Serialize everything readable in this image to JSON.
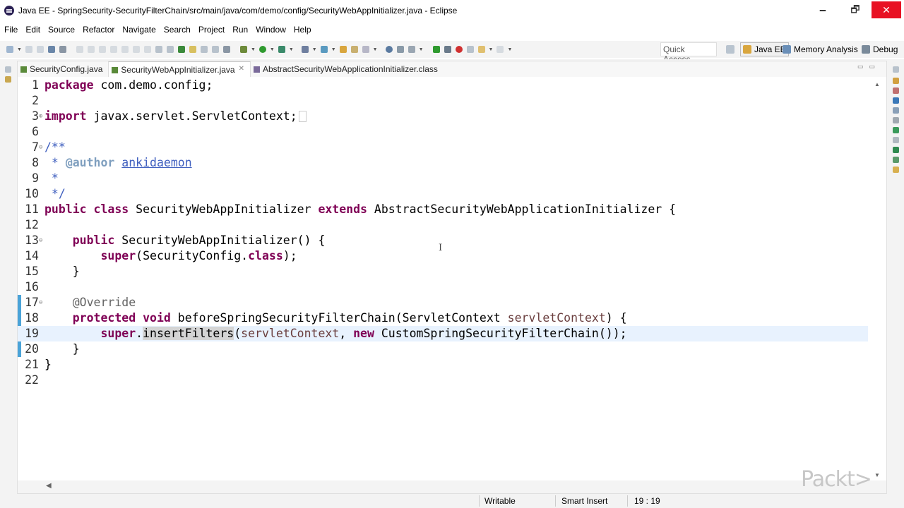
{
  "window": {
    "title": "Java EE - SpringSecurity-SecurityFilterChain/src/main/java/com/demo/config/SecurityWebAppInitializer.java - Eclipse",
    "controls": {
      "minimize": "🗕",
      "restore": "🗗",
      "close": "✕"
    }
  },
  "menu": [
    "File",
    "Edit",
    "Source",
    "Refactor",
    "Navigate",
    "Search",
    "Project",
    "Run",
    "Window",
    "Help"
  ],
  "toolbar": {
    "quick_access": "Quick Access",
    "perspectives": [
      "Java EE",
      "Memory Analysis",
      "Debug"
    ],
    "active_perspective": "Java EE"
  },
  "tabs": [
    {
      "label": "SecurityConfig.java",
      "icon": "java-file-icon"
    },
    {
      "label": "SecurityWebAppInitializer.java",
      "icon": "java-file-icon",
      "active": true,
      "close": "✕"
    },
    {
      "label": "AbstractSecurityWebApplicationInitializer.class",
      "icon": "class-file-icon"
    }
  ],
  "editor": {
    "lines": [
      {
        "n": "1",
        "fold": "",
        "html": "<span class=\"kw\">package</span> com.demo.config;"
      },
      {
        "n": "2",
        "fold": "",
        "html": ""
      },
      {
        "n": "3",
        "fold": "⊕",
        "html": "<span class=\"kw\">import</span> javax.servlet.ServletContext;<span class=\"fold-box\"></span>"
      },
      {
        "n": "6",
        "fold": "",
        "html": ""
      },
      {
        "n": "7",
        "fold": "⊖",
        "html": "<span class=\"cm\">/**</span>"
      },
      {
        "n": "8",
        "fold": "",
        "html": "<span class=\"cm\"> * </span><span class=\"tag\">@author</span><span class=\"cm\"> <u>ankidaemon</u></span>"
      },
      {
        "n": "9",
        "fold": "",
        "html": "<span class=\"cm\"> *</span>"
      },
      {
        "n": "10",
        "fold": "",
        "html": "<span class=\"cm\"> */</span>"
      },
      {
        "n": "11",
        "fold": "",
        "html": "<span class=\"kw\">public</span> <span class=\"kw\">class</span> SecurityWebAppInitializer <span class=\"kw\">extends</span> AbstractSecurityWebApplicationInitializer {"
      },
      {
        "n": "12",
        "fold": "",
        "html": ""
      },
      {
        "n": "13",
        "fold": "⊖",
        "html": "    <span class=\"kw\">public</span> SecurityWebAppInitializer() {"
      },
      {
        "n": "14",
        "fold": "",
        "html": "        <span class=\"kw\">super</span>(SecurityConfig.<span class=\"kw\">class</span>);"
      },
      {
        "n": "15",
        "fold": "",
        "html": "    }"
      },
      {
        "n": "16",
        "fold": "",
        "html": ""
      },
      {
        "n": "17",
        "fold": "⊖",
        "html": "    <span class=\"ann\">@Override</span>",
        "marker": true
      },
      {
        "n": "18",
        "fold": "",
        "html": "    <span class=\"kw\">protected</span> <span class=\"kw\">void</span> beforeSpringSecurityFilterChain(ServletContext <span class=\"var\">servletContext</span>) {",
        "marker": true
      },
      {
        "n": "19",
        "fold": "",
        "html": "        <span class=\"kw\">super</span>.<span class=\"occ\">insertFilters</span>(<span class=\"var\">servletContext</span>, <span class=\"kw\">new</span> CustomSpringSecurityFilterChain());",
        "marker": true,
        "current": true
      },
      {
        "n": "20",
        "fold": "",
        "html": "    }",
        "marker": true
      },
      {
        "n": "21",
        "fold": "",
        "html": "}"
      },
      {
        "n": "22",
        "fold": "",
        "html": ""
      }
    ]
  },
  "status": {
    "writable": "Writable",
    "insert_mode": "Smart Insert",
    "position": "19 : 19"
  },
  "watermark": "Packt>",
  "colors": {
    "keyword": "#7f0055",
    "comment": "#3f5fbf",
    "annotation": "#646464",
    "variable": "#6a3e3e",
    "current_line": "#e8f2fe",
    "close_button": "#e81123"
  }
}
